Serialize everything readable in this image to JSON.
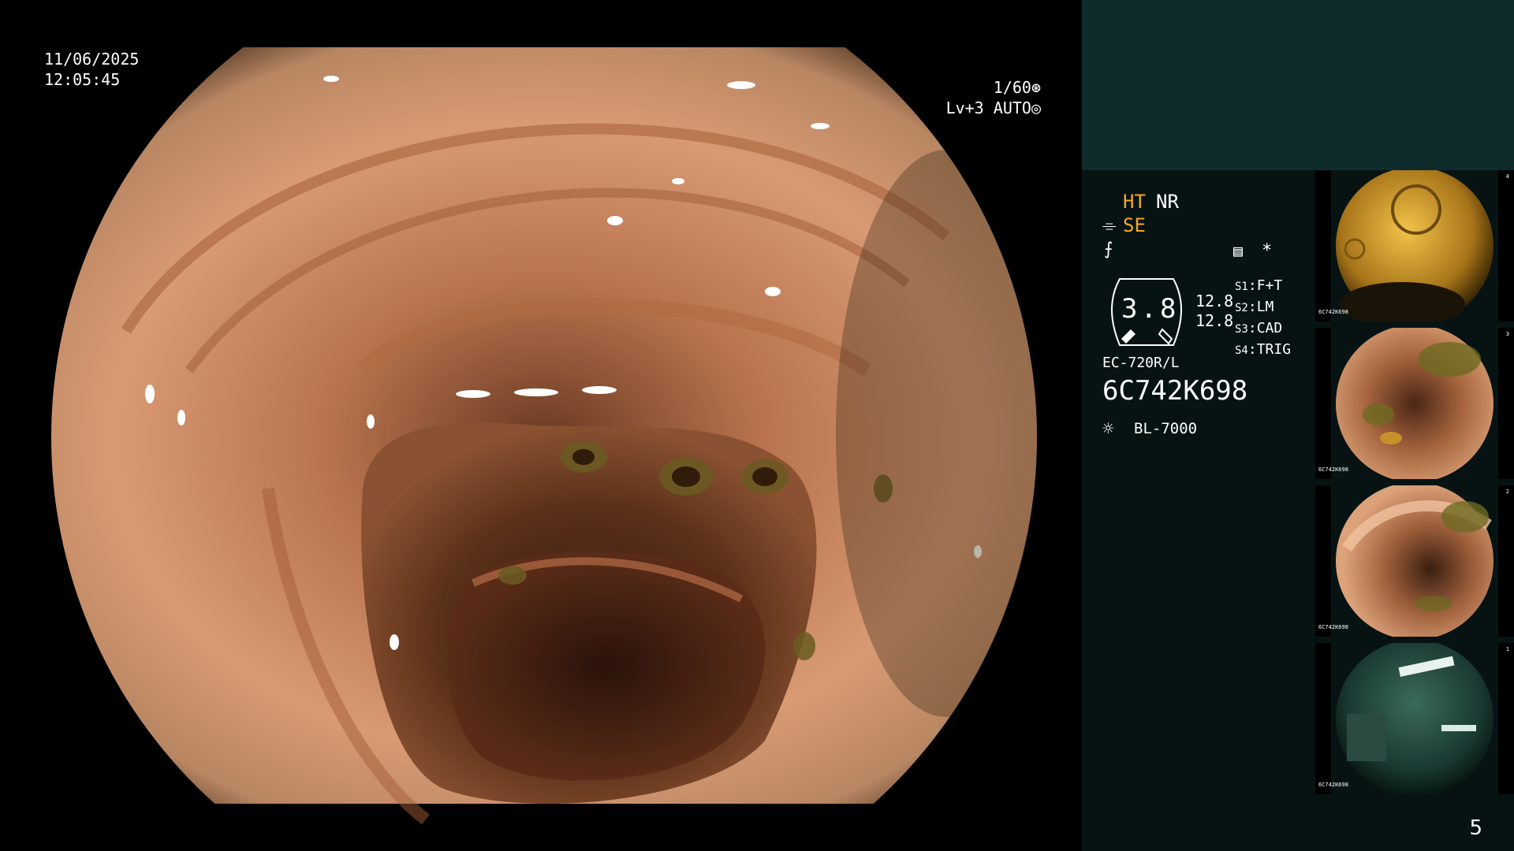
{
  "overlay": {
    "date": "11/06/2025",
    "time": "12:05:45",
    "shutter": "1/60",
    "level": "Lv+3",
    "mode": "AUTO"
  },
  "status": {
    "ht": "HT",
    "nr": "NR",
    "se": "SE",
    "gauge_value": "3.8",
    "gauge_top": "12.8",
    "gauge_bottom": "12.8",
    "asterisk": "*",
    "switches": [
      {
        "key": "S1",
        "val": "F+T"
      },
      {
        "key": "S2",
        "val": "LM"
      },
      {
        "key": "S3",
        "val": "CAD"
      },
      {
        "key": "S4",
        "val": "TRIG"
      }
    ],
    "scope_model": "EC-720R/L",
    "serial": "6C742K698",
    "light_source": "BL-7000"
  },
  "thumbnails": [
    {
      "label": "6C742K698",
      "counter": "4"
    },
    {
      "label": "6C742K698",
      "counter": "3"
    },
    {
      "label": "6C742K698",
      "counter": "2"
    },
    {
      "label": "6C742K698",
      "counter": "1"
    }
  ],
  "page_number": "5",
  "colors": {
    "accent": "#f4a623",
    "panel_top": "#0f2b2b",
    "panel": "#071313",
    "mucosa": "#c98a63"
  }
}
